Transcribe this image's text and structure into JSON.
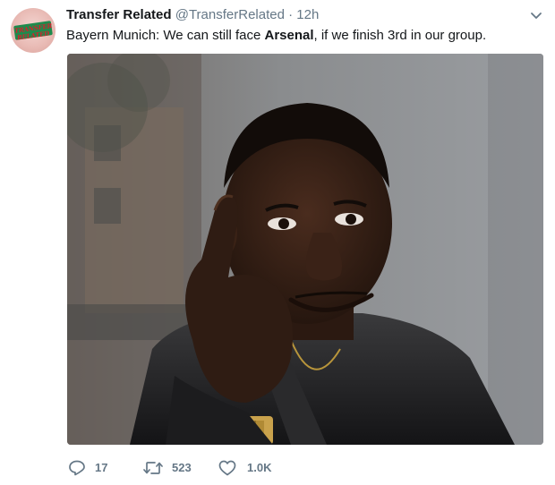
{
  "tweet": {
    "author_name": "Transfer Related",
    "author_handle": "@TransferRelated",
    "separator": "·",
    "timestamp": "12h",
    "text_before": "Bayern Munich: We can still face ",
    "text_bold": "Arsenal",
    "text_after": ", if we finish 3rd in our group."
  },
  "avatar": {
    "logo_line1": "TRANSFER",
    "logo_line2": "RELATED"
  },
  "actions": {
    "reply_count": "17",
    "retweet_count": "523",
    "like_count": "1.0K"
  },
  "icons": {
    "menu": "chevron-down-icon",
    "reply": "reply-icon",
    "retweet": "retweet-icon",
    "like": "heart-icon"
  },
  "colors": {
    "text": "#14171a",
    "secondary": "#657786",
    "avatar_green": "#1f8a4c",
    "avatar_red": "#d61f2c"
  }
}
